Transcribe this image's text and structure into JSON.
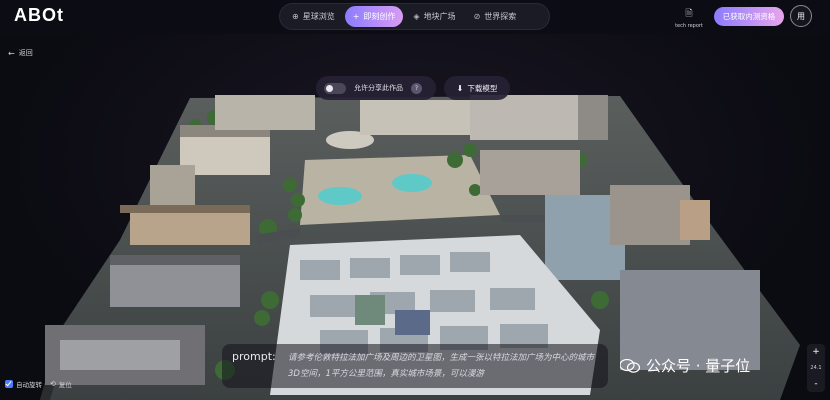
{
  "app": {
    "logo": "ABOt"
  },
  "nav": {
    "items": [
      {
        "label": "星球浏览",
        "icon": "globe-icon"
      },
      {
        "label": "即刻创作",
        "icon": "plus-icon",
        "active": true
      },
      {
        "label": "地块广场",
        "icon": "layers-icon"
      },
      {
        "label": "世界探索",
        "icon": "compass-icon"
      }
    ]
  },
  "header": {
    "tech_report": "tech report",
    "invite_button": "已获取内测资格",
    "avatar_text": "用"
  },
  "back": {
    "label": "返回"
  },
  "share": {
    "label": "允许分享此作品",
    "help": "?"
  },
  "download": {
    "label": "下载模型"
  },
  "prompt": {
    "label": "prompt:",
    "text": "请参考伦敦特拉法加广场及周边的卫星图，生成一张以特拉法加广场为中心的城市3D空间，1平方公里范围，真实城市场景，可以漫游"
  },
  "watermark": {
    "text": "公众号 · 量子位"
  },
  "zoom": {
    "plus": "+",
    "level": "24.1",
    "minus": "-"
  },
  "footer": {
    "auto_rotate": "自动旋转",
    "reset": "复位"
  },
  "colors": {
    "accent_start": "#8c7cff",
    "accent_end": "#e7a5ea",
    "background": "#0b0b12"
  }
}
